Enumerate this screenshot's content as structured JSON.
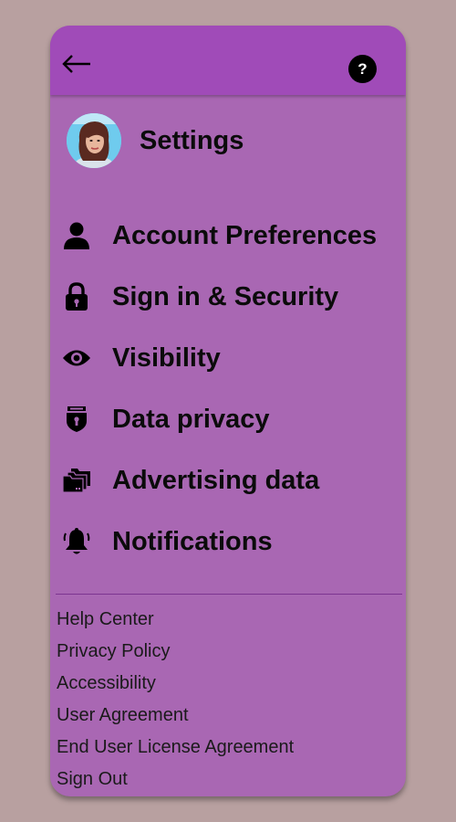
{
  "header": {
    "back_icon": "arrow-left-icon",
    "help_label": "?"
  },
  "profile": {
    "title": "Settings"
  },
  "menu": {
    "items": [
      {
        "label": "Account Preferences",
        "icon": "person-icon"
      },
      {
        "label": "Sign in & Security",
        "icon": "lock-icon"
      },
      {
        "label": "Visibility",
        "icon": "eye-icon"
      },
      {
        "label": "Data privacy",
        "icon": "shield-icon"
      },
      {
        "label": "Advertising data",
        "icon": "folders-icon"
      },
      {
        "label": "Notifications",
        "icon": "bell-icon"
      }
    ]
  },
  "footer": {
    "links": [
      "Help Center",
      "Privacy Policy",
      "Accessibility",
      "User Agreement",
      "End User License Agreement",
      "Sign Out"
    ]
  },
  "colors": {
    "background": "#b8a0a0",
    "card": "#a967b3",
    "header": "#a04bb8"
  }
}
